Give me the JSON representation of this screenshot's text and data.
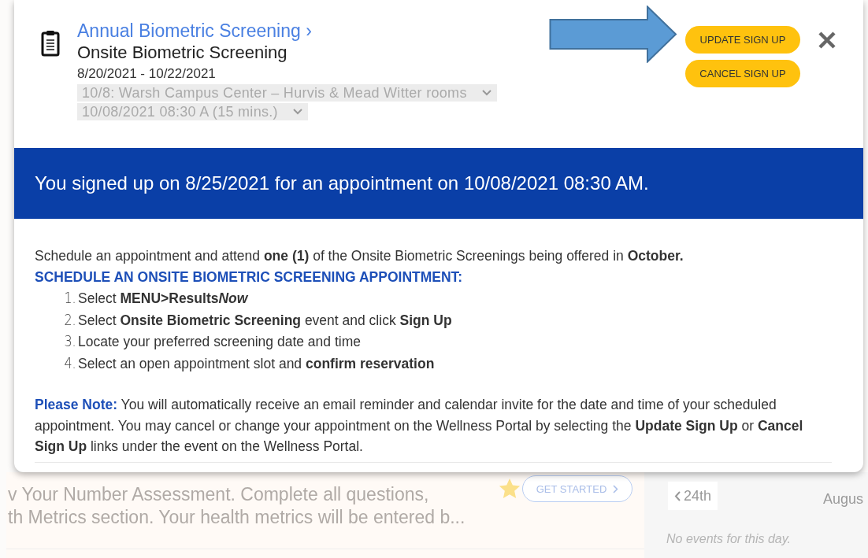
{
  "event": {
    "category_link": "Annual Biometric Screening ›",
    "title": "Onsite Biometric Screening",
    "date_range": "8/20/2021 - 10/22/2021",
    "location_select": {
      "value": "10/8: Warsh Campus Center – Hurvis & Mead Witter rooms",
      "disabled": true
    },
    "time_select": {
      "value": "10/08/2021 08:30 A (15 mins.)",
      "disabled": true
    }
  },
  "buttons": [
    "UPDATE SIGN UP",
    "CANCEL SIGN UP"
  ],
  "banner": "You signed up on 8/25/2021 for an appointment on 10/08/2021 08:30 AM.",
  "instructions": {
    "intro": "Schedule an appointment and attend **one (1)** of the Onsite Biometric Screenings being offered in **October.**",
    "heading": "SCHEDULE AN ONSITE BIOMETRIC SCREENING APPOINTMENT:",
    "steps": [
      {
        "number": "1.",
        "text": "Select **MENU>Results**",
        "bold_italic_suffix": "Now"
      },
      {
        "number": "2.",
        "text": "Select **Onsite Biometric Screening** event and click **Sign Up**"
      },
      {
        "number": "3.",
        "text": "Locate your preferred screening date and time"
      },
      {
        "number": "4.",
        "text": "Select an open appointment slot and **confirm reservation**"
      }
    ],
    "note_label": "Please Note:",
    "note": "You will automatically receive an email reminder and calendar invite for the date and time of your scheduled appointment. You may cancel or change your appointment on the Wellness Portal by selecting the **Update Sign Up** or **Cancel Sign Up** links under the event on the Wellness Portal."
  },
  "background": {
    "assessment_line_1": "v Your Number Assessment. Complete all questions,",
    "assessment_line_2": "th Metrics section. Your health metrics will be entered b...",
    "get_started": "GET STARTED",
    "prev_day": "24th",
    "month": "Augus",
    "empty_message": "No events for this day."
  }
}
